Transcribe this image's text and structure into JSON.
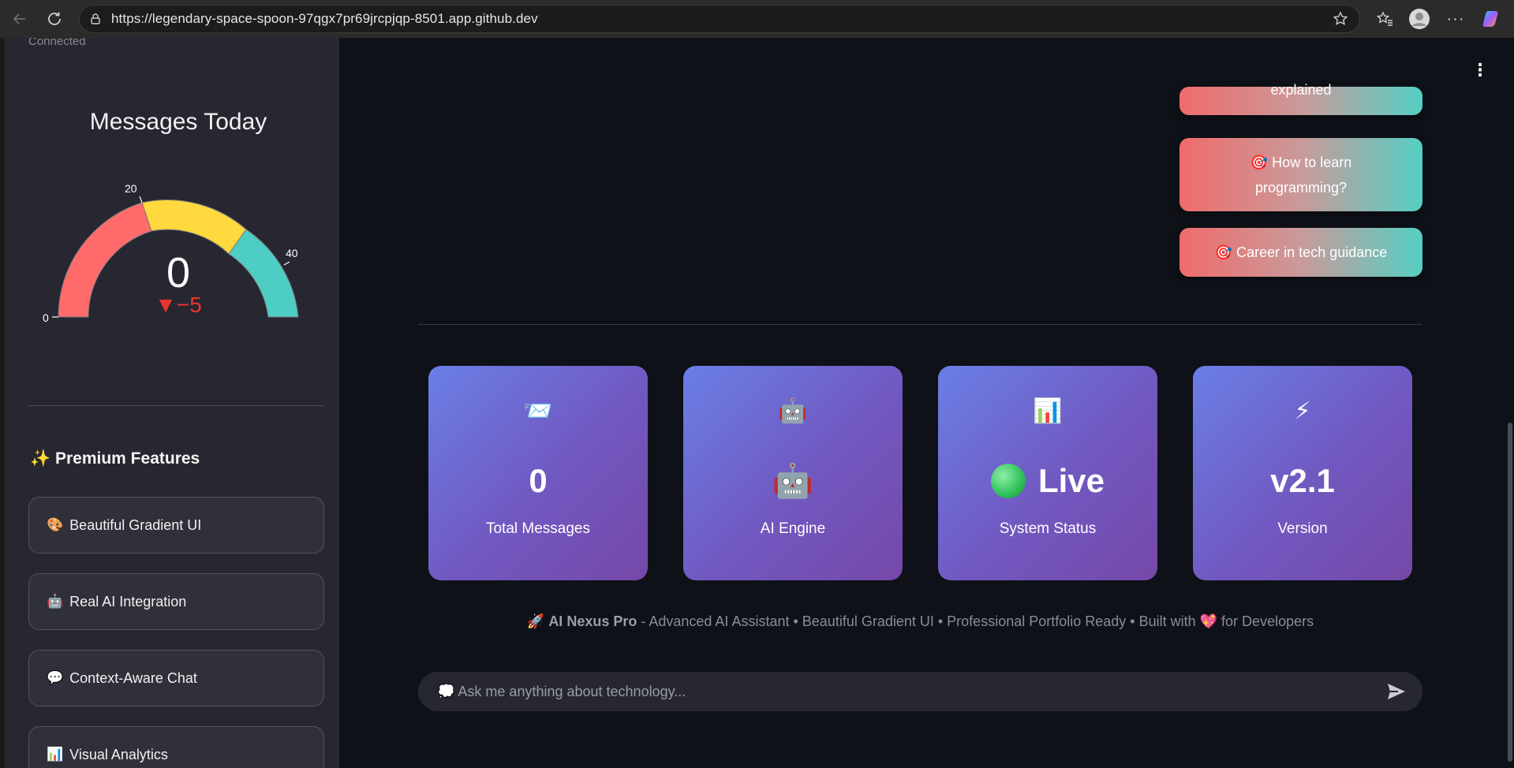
{
  "browser": {
    "url": "https://legendary-space-spoon-97qgx7pr69jrcpjqp-8501.app.github.dev"
  },
  "sidebar": {
    "connected_text": "Connected",
    "gauge": {
      "title": "Messages Today",
      "value": "0",
      "delta": "▼−5",
      "min_label": "0",
      "tick_20": "20",
      "tick_40": "40",
      "value_numeric": 0,
      "range": [
        0,
        50
      ],
      "bands": [
        {
          "from": 0,
          "to": 20,
          "color": "#ff6b6b"
        },
        {
          "from": 20,
          "to": 35,
          "color": "#ffd93d"
        },
        {
          "from": 35,
          "to": 50,
          "color": "#4ecdc4"
        }
      ]
    },
    "features_title": "✨ Premium Features",
    "features": [
      {
        "emoji": "🎨",
        "label": "Beautiful Gradient UI"
      },
      {
        "emoji": "🤖",
        "label": "Real AI Integration"
      },
      {
        "emoji": "💬",
        "label": "Context-Aware Chat"
      },
      {
        "emoji": "📊",
        "label": "Visual Analytics"
      }
    ]
  },
  "main": {
    "suggestions": [
      {
        "label": "explained"
      },
      {
        "label": "🎯 How to learn programming?"
      },
      {
        "label": "🎯 Career in tech guidance"
      }
    ],
    "stats": [
      {
        "icon": "📨",
        "value": "0",
        "label": "Total Messages"
      },
      {
        "icon": "🤖",
        "value": "🤖",
        "label": "AI Engine"
      },
      {
        "icon": "📊",
        "value": "Live",
        "label": "System Status"
      },
      {
        "icon": "⚡",
        "value": "v2.1",
        "label": "Version"
      }
    ],
    "footer": {
      "rocket": "🚀",
      "brand": "AI Nexus Pro",
      "text": " - Advanced AI Assistant • Beautiful Gradient UI • Professional Portfolio Ready • Built with ",
      "heart": "💖",
      "suffix": " for Developers"
    },
    "chat": {
      "placeholder": "💭 Ask me anything about technology..."
    }
  },
  "colors": {
    "sidebar_bg": "#262730",
    "main_bg": "#0e1117",
    "card_gradient_start": "#667eea",
    "card_gradient_end": "#764ba2",
    "suggestion_start": "#ff6b6b",
    "suggestion_end": "#4ecdc4"
  }
}
